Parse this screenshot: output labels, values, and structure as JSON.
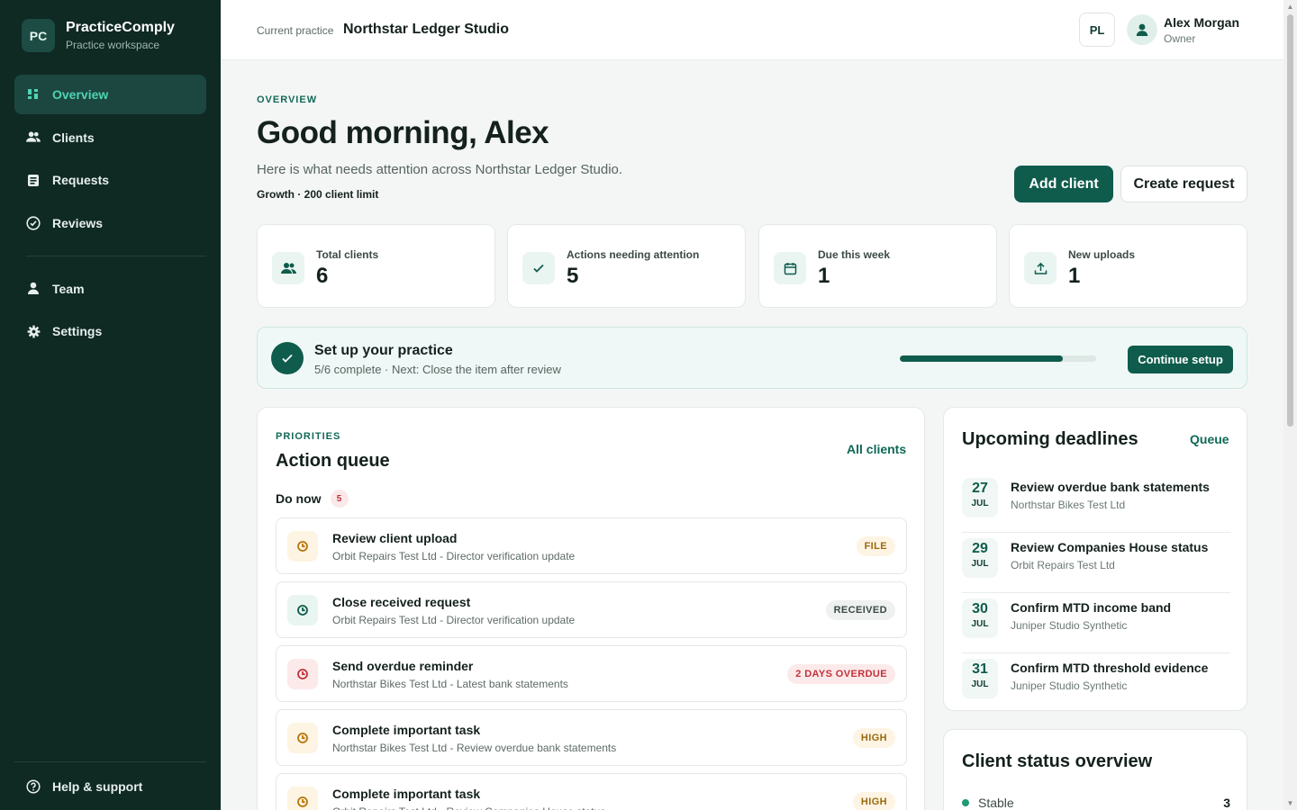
{
  "brand": {
    "logo": "PC",
    "name": "PracticeComply",
    "subtitle": "Practice workspace"
  },
  "nav": {
    "items": [
      {
        "label": "Overview",
        "icon": "grid-icon",
        "active": true
      },
      {
        "label": "Clients",
        "icon": "users-icon"
      },
      {
        "label": "Requests",
        "icon": "document-icon"
      },
      {
        "label": "Reviews",
        "icon": "check-circle-icon"
      }
    ],
    "secondary": [
      {
        "label": "Team",
        "icon": "person-icon"
      },
      {
        "label": "Settings",
        "icon": "gear-icon"
      }
    ],
    "help": "Help & support"
  },
  "header": {
    "current_label": "Current practice",
    "current_name": "Northstar Ledger Studio",
    "practice_badge": "PL",
    "user_name": "Alex Morgan",
    "user_role": "Owner"
  },
  "overview": {
    "eyebrow": "OVERVIEW",
    "greeting": "Good morning, Alex",
    "subtitle": "Here is what needs attention across Northstar Ledger Studio.",
    "plan": "Growth · 200 client limit",
    "add_client": "Add client",
    "create_request": "Create request"
  },
  "stats": [
    {
      "label": "Total clients",
      "value": "6",
      "icon": "users-icon"
    },
    {
      "label": "Actions needing attention",
      "value": "5",
      "icon": "check-icon"
    },
    {
      "label": "Due this week",
      "value": "1",
      "icon": "calendar-icon"
    },
    {
      "label": "New uploads",
      "value": "1",
      "icon": "upload-icon"
    }
  ],
  "setup": {
    "title": "Set up your practice",
    "subtitle": "5/6 complete · Next: Close the item after review",
    "progress": 0.83,
    "button": "Continue setup"
  },
  "queue": {
    "eyebrow": "PRIORITIES",
    "title": "Action queue",
    "link": "All clients",
    "section": "Do now",
    "count": "5",
    "items": [
      {
        "title": "Review client upload",
        "detail": "Orbit Repairs Test Ltd - Director verification update",
        "tag": "FILE",
        "tone": "amber"
      },
      {
        "title": "Close received request",
        "detail": "Orbit Repairs Test Ltd - Director verification update",
        "tag": "RECEIVED",
        "tone": "green"
      },
      {
        "title": "Send overdue reminder",
        "detail": "Northstar Bikes Test Ltd - Latest bank statements",
        "tag": "2 DAYS OVERDUE",
        "tone": "red"
      },
      {
        "title": "Complete important task",
        "detail": "Northstar Bikes Test Ltd - Review overdue bank statements",
        "tag": "HIGH",
        "tone": "amber"
      },
      {
        "title": "Complete important task",
        "detail": "Orbit Repairs Test Ltd - Review Companies House status",
        "tag": "HIGH",
        "tone": "amber"
      }
    ]
  },
  "deadlines": {
    "title": "Upcoming deadlines",
    "link": "Queue",
    "items": [
      {
        "day": "27",
        "month": "JUL",
        "title": "Review overdue bank statements",
        "client": "Northstar Bikes Test Ltd"
      },
      {
        "day": "29",
        "month": "JUL",
        "title": "Review Companies House status",
        "client": "Orbit Repairs Test Ltd"
      },
      {
        "day": "30",
        "month": "JUL",
        "title": "Confirm MTD income band",
        "client": "Juniper Studio Synthetic"
      },
      {
        "day": "31",
        "month": "JUL",
        "title": "Confirm MTD threshold evidence",
        "client": "Juniper Studio Synthetic"
      }
    ]
  },
  "status_overview": {
    "title": "Client status overview",
    "rows": [
      {
        "label": "Stable",
        "count": "3",
        "color": "#1d9a76"
      }
    ]
  },
  "colors": {
    "sidebar": "#0f2923",
    "accent": "#0f5c4c",
    "active_nav": "#4fd4b4"
  }
}
